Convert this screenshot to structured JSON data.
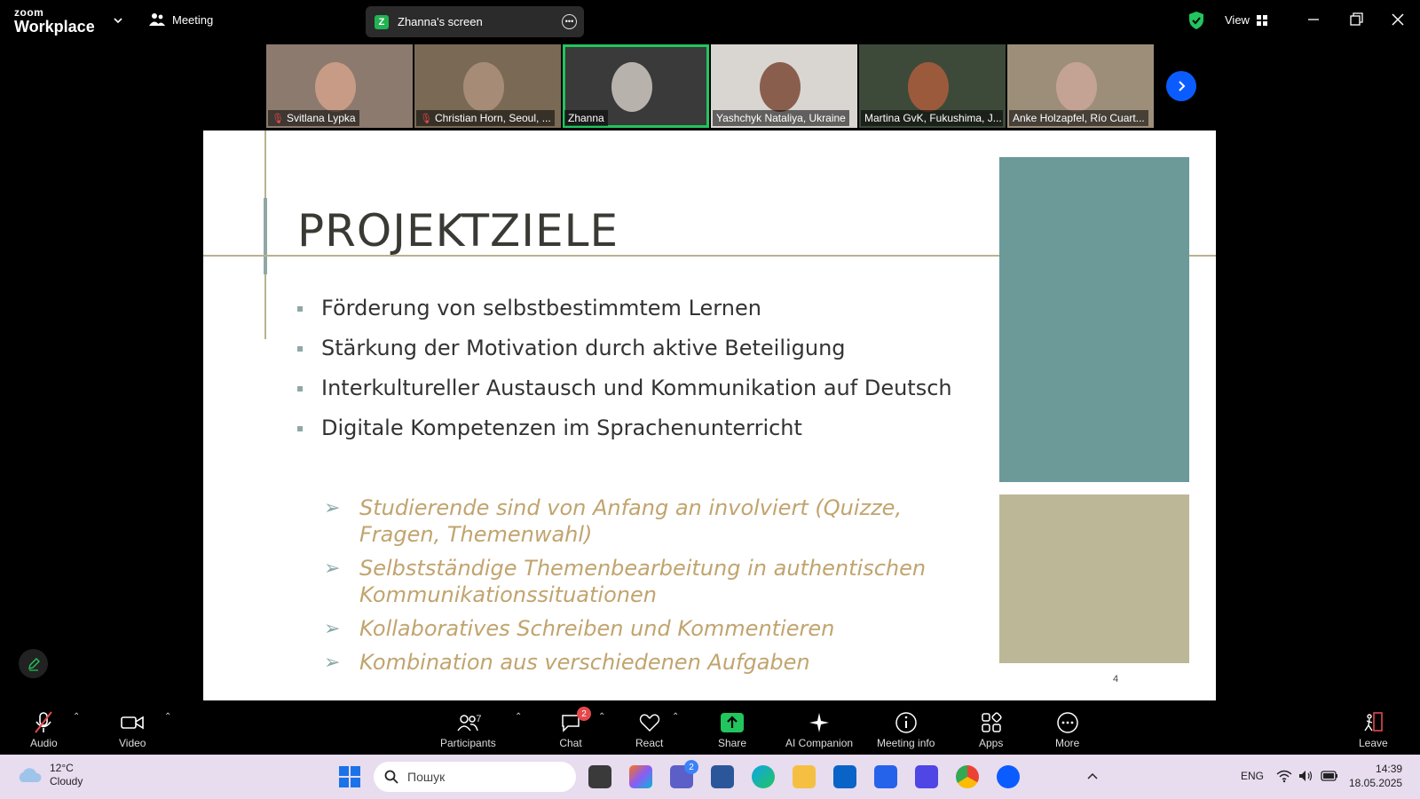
{
  "app": {
    "brand_small": "zoom",
    "brand_large": "Workplace",
    "meeting_label": "Meeting",
    "view_label": "View"
  },
  "share": {
    "badge": "Z",
    "label": "Zhanna's screen"
  },
  "participants": [
    {
      "name": "Svitlana Lypka",
      "muted": true,
      "bg": "#8c7a6e",
      "face": "#c79b86",
      "active": false
    },
    {
      "name": "Christian Horn, Seoul, ...",
      "muted": true,
      "bg": "#7a6a55",
      "face": "#a68c76",
      "active": false
    },
    {
      "name": "Zhanna",
      "muted": false,
      "bg": "#3a3a3a",
      "face": "#b8b2ad",
      "active": true
    },
    {
      "name": "Yashchyk Nataliya, Ukraine",
      "muted": false,
      "bg": "#d9d6d2",
      "face": "#8a5e4c",
      "active": false
    },
    {
      "name": "Martina GvK, Fukushima, J...",
      "muted": false,
      "bg": "#3d4a3a",
      "face": "#9c5a3c",
      "active": false
    },
    {
      "name": "Anke Holzapfel, Río Cuart...",
      "muted": false,
      "bg": "#9d8e7a",
      "face": "#c5a394",
      "active": false
    }
  ],
  "slide": {
    "title": "PROJEKTZIELE",
    "bullets": [
      "Förderung von selbstbestimmtem Lernen",
      "Stärkung der Motivation durch aktive Beteiligung",
      "Interkultureller Austausch und Kommunikation auf Deutsch",
      "Digitale Kompetenzen im Sprachenunterricht"
    ],
    "sub_bullets": [
      "Studierende sind von Anfang an involviert (Quizze, Fragen, Themenwahl)",
      "Selbstständige Themenbearbeitung in authentischen Kommunikationssituationen",
      "Kollaboratives Schreiben und Kommentieren",
      "Kombination aus verschiedenen Aufgaben"
    ],
    "page_number": "4",
    "colors": {
      "teal": "#6b9a98",
      "tan": "#bcb796",
      "accent_gold": "#c1a46e"
    }
  },
  "toolbar": {
    "audio": "Audio",
    "video": "Video",
    "participants": "Participants",
    "participants_count": "7",
    "chat": "Chat",
    "chat_badge": "2",
    "react": "React",
    "share": "Share",
    "ai": "AI Companion",
    "info": "Meeting info",
    "apps": "Apps",
    "more": "More",
    "leave": "Leave"
  },
  "taskbar": {
    "temp": "12°C",
    "condition": "Cloudy",
    "search_placeholder": "Пошук",
    "language": "ENG",
    "time": "14:39",
    "date": "18.05.2025",
    "teams_badge": "2"
  }
}
